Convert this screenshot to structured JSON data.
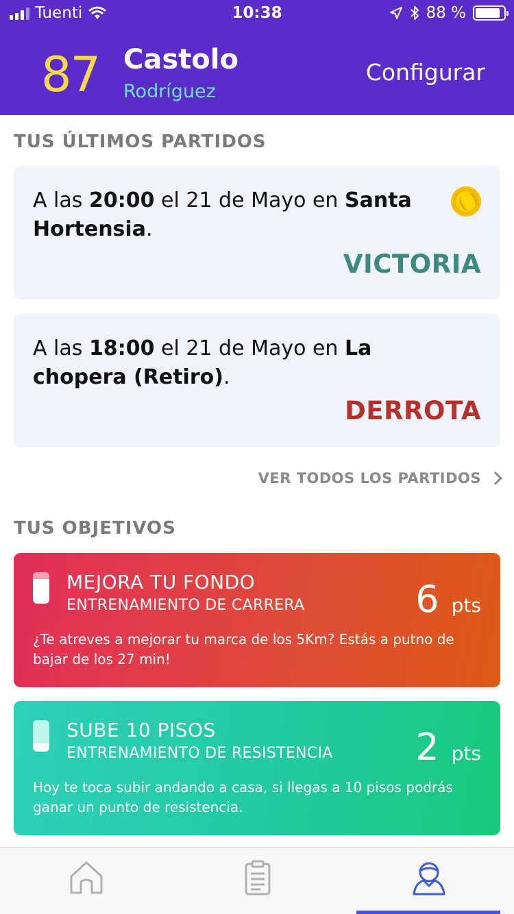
{
  "status_bar": {
    "carrier": "Tuenti",
    "time": "10:38",
    "battery": "88 %",
    "battery_level": 0.88
  },
  "header": {
    "score": "87",
    "first_name": "Castolo",
    "last_name": "Rodríguez",
    "configure_label": "Configurar"
  },
  "matches": {
    "section_title": "TUS ÚLTIMOS PARTIDOS",
    "items": [
      {
        "prefix": "A las ",
        "time": "20:00",
        "middle": " el 21 de Mayo en ",
        "place": "Santa Hortensia",
        "suffix": ".",
        "result": "VICTORIA",
        "result_color": "#3f8a7e"
      },
      {
        "prefix": "A las ",
        "time": "18:00",
        "middle": " el 21 de Mayo en ",
        "place": "La chopera (Retiro)",
        "suffix": ".",
        "result": "DERROTA",
        "result_color": "#b7312c"
      }
    ],
    "see_all_label": "VER TODOS LOS PARTIDOS"
  },
  "goals": {
    "section_title": "TUS OBJETIVOS",
    "items": [
      {
        "title": "MEJORA TU FONDO",
        "subtitle": "ENTRENAMIENTO DE CARRERA",
        "points": "6",
        "points_unit": "pts",
        "description": "¿Te atreves a mejorar tu marca de los 5Km? Estás a putno de bajar de los 27 min!"
      },
      {
        "title": "SUBE 10 PISOS",
        "subtitle": "ENTRENAMIENTO DE RESISTENCIA",
        "points": "2",
        "points_unit": "pts",
        "description": "Hoy te toca subir andando a casa, si llegas a 10 pisos podrás ganar un punto de resistencia."
      }
    ]
  },
  "tabbar": {
    "tabs": [
      {
        "icon": "home-icon",
        "active": false
      },
      {
        "icon": "clipboard-icon",
        "active": false
      },
      {
        "icon": "profile-icon",
        "active": true
      }
    ],
    "colors": {
      "inactive": "#b0b0b0",
      "active": "#3b5bd6"
    }
  }
}
